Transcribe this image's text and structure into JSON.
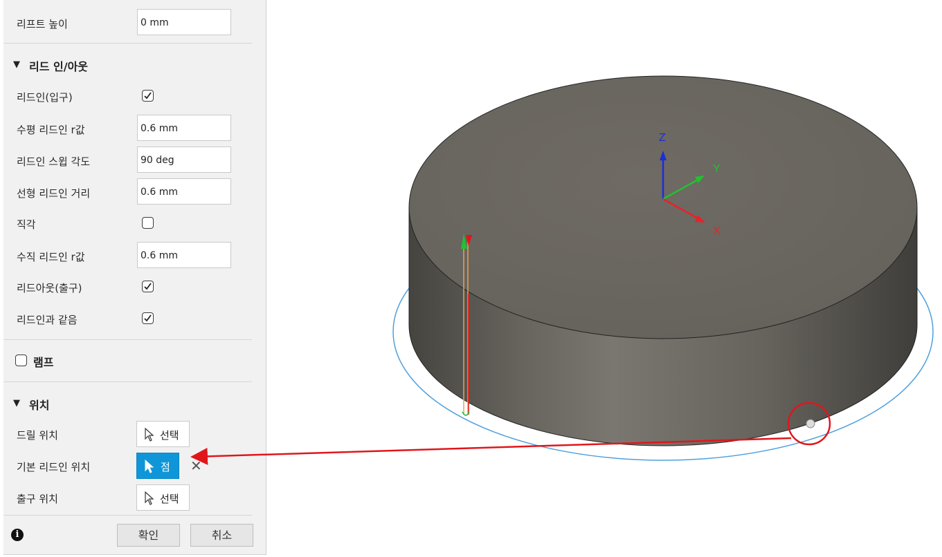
{
  "panel": {
    "lift": {
      "label": "리프트 높이",
      "value": "0 mm"
    },
    "leads": {
      "title": "리드 인/아웃",
      "lead_in": {
        "label": "리드인(입구)",
        "checked": true
      },
      "horizontal_lead_in_radius": {
        "label": "수평 리드인 r값",
        "value": "0.6 mm"
      },
      "lead_in_sweep_angle": {
        "label": "리드인 스윕 각도",
        "value": "90 deg"
      },
      "linear_lead_in_distance": {
        "label": "선형 리드인 거리",
        "value": "0.6 mm"
      },
      "perpendicular": {
        "label": "직각",
        "checked": false
      },
      "vertical_lead_in_radius": {
        "label": "수직 리드인 r값",
        "value": "0.6 mm"
      },
      "lead_out": {
        "label": "리드아웃(출구)",
        "checked": true
      },
      "same_as_lead_in": {
        "label": "리드인과 같음",
        "checked": true
      }
    },
    "ramp": {
      "title": "램프",
      "checked": false
    },
    "positions": {
      "title": "위치",
      "drill_position": {
        "label": "드릴 위치",
        "button": "선택"
      },
      "default_lead_in_position": {
        "label": "기본 리드인 위치",
        "button": "점"
      },
      "exit_position": {
        "label": "출구 위치",
        "button": "선택"
      }
    },
    "footer": {
      "ok": "확인",
      "cancel": "취소"
    }
  },
  "viewport": {
    "axes": {
      "x": "X",
      "y": "Y",
      "z": "Z"
    },
    "colors": {
      "body_top": "#6d6862",
      "body_side": "#5c5954",
      "outline": "#4e9fdd",
      "annotation": "#e0161b",
      "x_axis": "#e8222a",
      "y_axis": "#22c12f",
      "z_axis": "#1a2fd6"
    }
  }
}
